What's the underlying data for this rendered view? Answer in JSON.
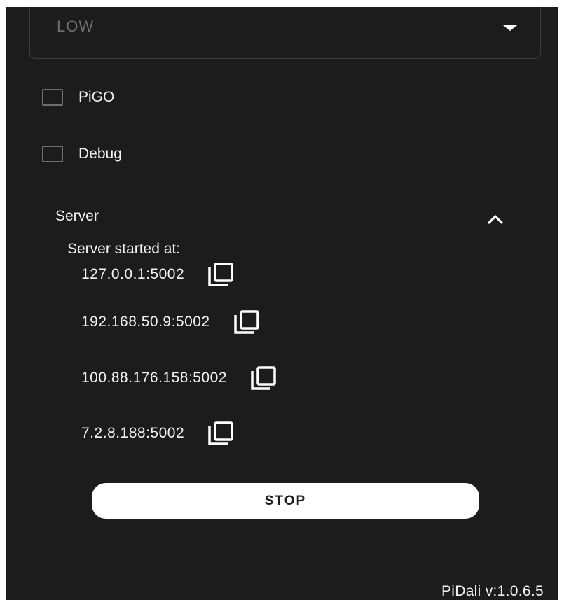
{
  "quality_dropdown": {
    "value": "LOW",
    "caret_icon": "caret-down-icon"
  },
  "checkboxes": [
    {
      "label": "PiGO",
      "checked": false
    },
    {
      "label": "Debug",
      "checked": false
    }
  ],
  "server": {
    "title": "Server",
    "toggle_icon": "chevron-up-icon",
    "started_label": "Server started at:",
    "addresses": [
      {
        "address": "127.0.0.1:5002",
        "copy_icon": "copy-icon"
      },
      {
        "address": "192.168.50.9:5002",
        "copy_icon": "copy-icon"
      },
      {
        "address": "100.88.176.158:5002",
        "copy_icon": "copy-icon"
      },
      {
        "address": "7.2.8.188:5002",
        "copy_icon": "copy-icon"
      }
    ],
    "stop_label": "STOP"
  },
  "footer": {
    "version": "PiDali v:1.0.6.5"
  },
  "colors": {
    "background": "#1c1c1c",
    "text": "#f2f2f2",
    "muted_text": "#6f6f6f",
    "button_bg": "#ffffff"
  }
}
